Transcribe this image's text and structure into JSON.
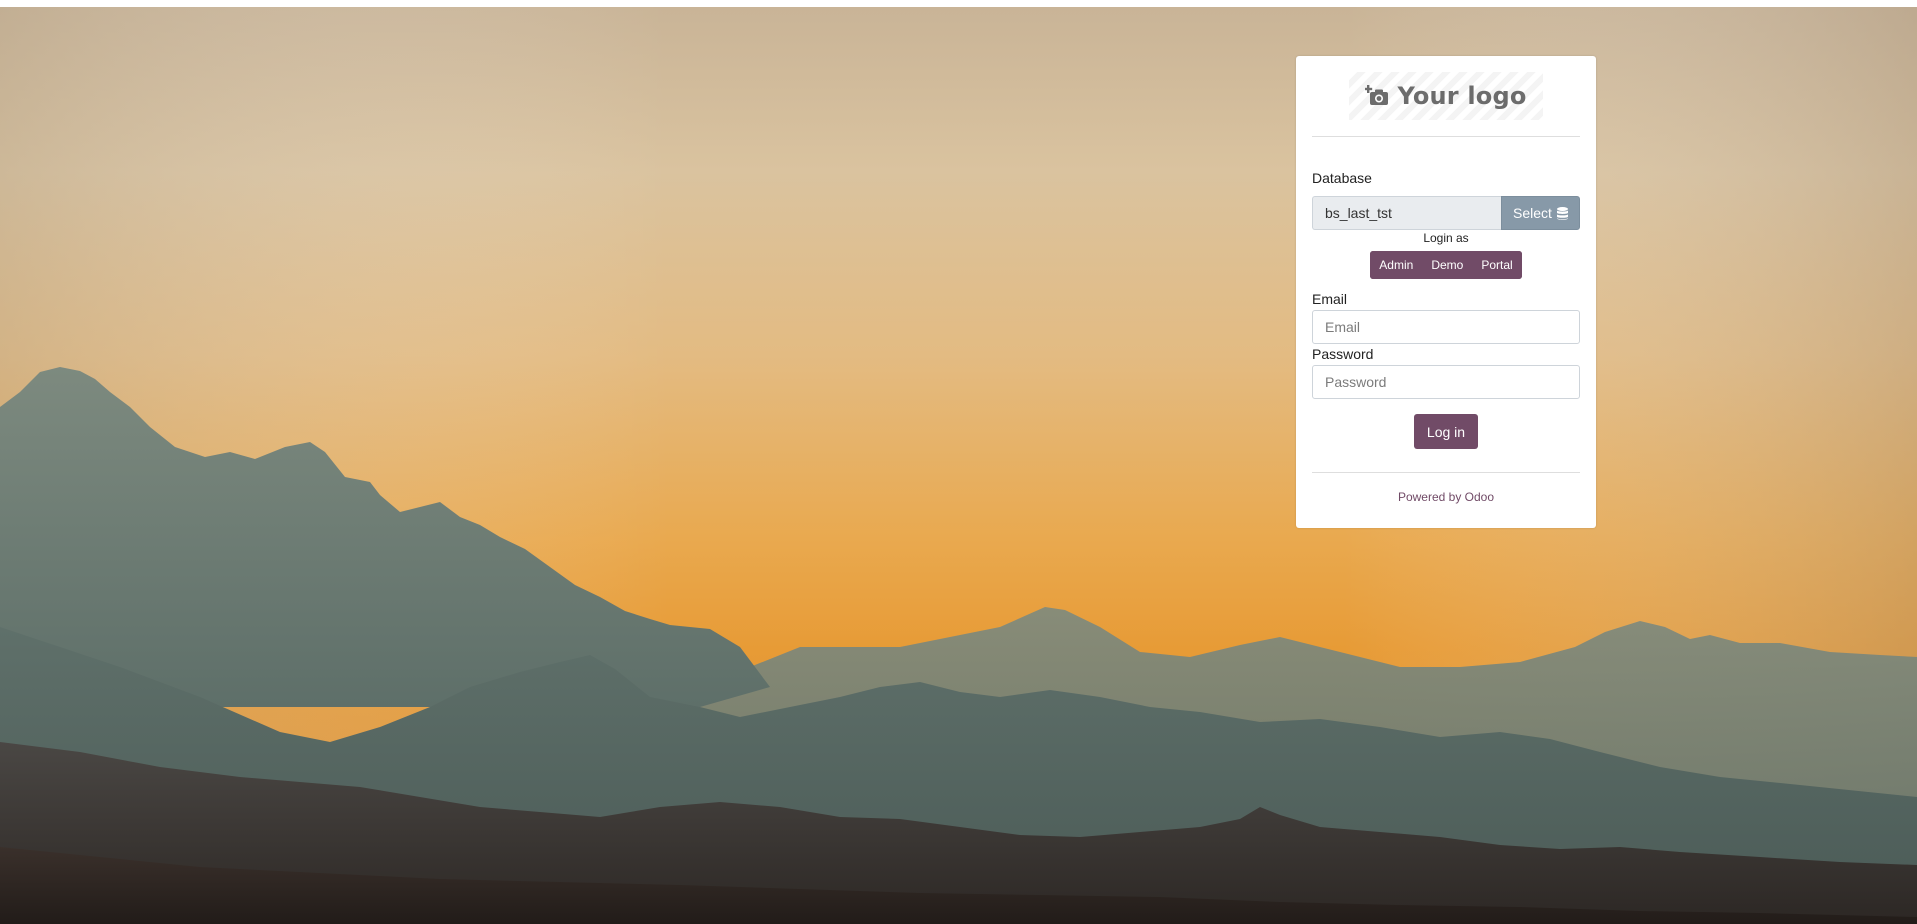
{
  "colors": {
    "brand": "#714b67",
    "select_button": "#8799a8",
    "sky_top": "#c9b497",
    "sky_bottom": "#e59a36"
  },
  "logo": {
    "text": "Your logo",
    "icon": "camera-plus-icon"
  },
  "database": {
    "label": "Database",
    "value": "bs_last_tst",
    "select_label": "Select",
    "select_icon": "database-icon"
  },
  "login_as": {
    "label": "Login as",
    "buttons": [
      "Admin",
      "Demo",
      "Portal"
    ]
  },
  "email": {
    "label": "Email",
    "placeholder": "Email",
    "value": ""
  },
  "password": {
    "label": "Password",
    "placeholder": "Password",
    "value": ""
  },
  "login_button": "Log in",
  "footer": {
    "prefix": "Powered by",
    "link": "Odoo"
  }
}
